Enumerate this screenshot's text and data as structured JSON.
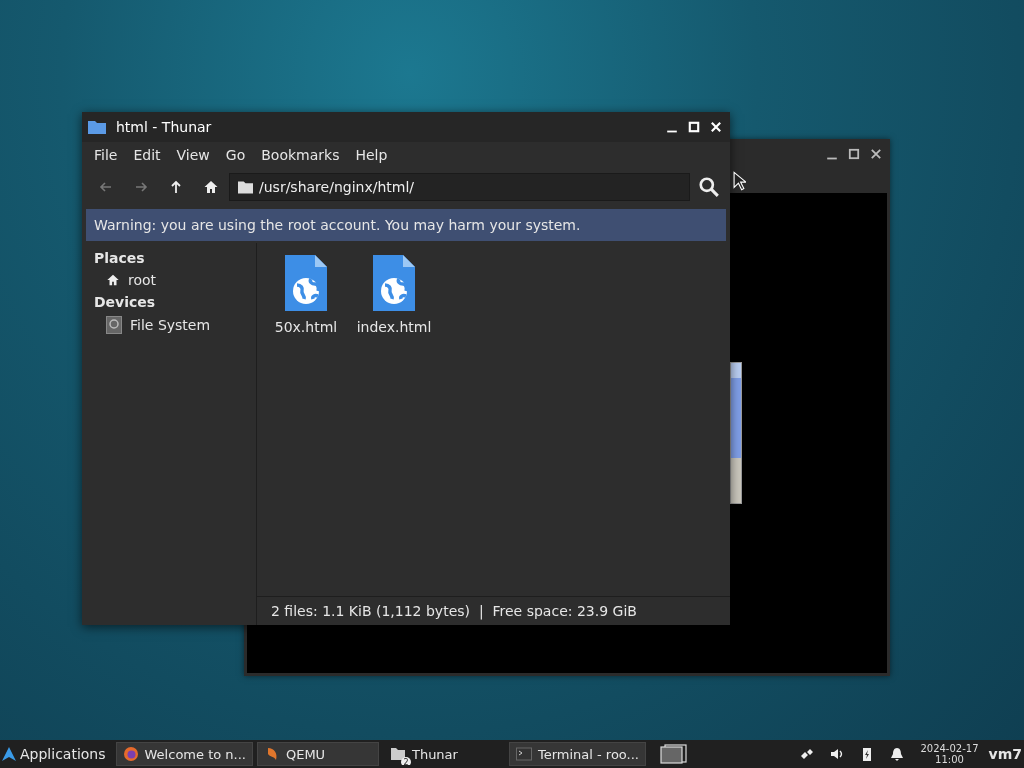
{
  "window": {
    "title": "html - Thunar"
  },
  "menu": [
    "File",
    "Edit",
    "View",
    "Go",
    "Bookmarks",
    "Help"
  ],
  "toolbar": {
    "back_disabled": true,
    "forward_disabled": true,
    "path": "/usr/share/nginx/html/"
  },
  "warning": "Warning: you are using the root account. You may harm your system.",
  "sidebar": [
    {
      "heading": "Places",
      "items": [
        {
          "label": "root",
          "kind": "home",
          "selected": false
        }
      ]
    },
    {
      "heading": "Devices",
      "items": [
        {
          "label": "File System",
          "kind": "drive",
          "selected": false
        }
      ]
    }
  ],
  "files": [
    {
      "name": "50x.html",
      "selected": false
    },
    {
      "name": "index.html",
      "selected": false
    }
  ],
  "status_bar": "2 files: 1.1 KiB (1,112 bytes)  |  Free space: 23.9 GiB",
  "taskbar": {
    "menu_label": "Applications",
    "tasks": [
      {
        "label": "Welcome to n...",
        "kind": "browser",
        "selected": false
      },
      {
        "label": "QEMU",
        "kind": "qemu",
        "selected": false
      },
      {
        "label": "Thunar",
        "kind": "files",
        "badge": "2",
        "selected": true
      },
      {
        "label": "Terminal - roo...",
        "kind": "terminal",
        "selected": false
      }
    ],
    "clock_date": "2024-02-17",
    "clock_time": "11:00",
    "user": "vm7"
  }
}
